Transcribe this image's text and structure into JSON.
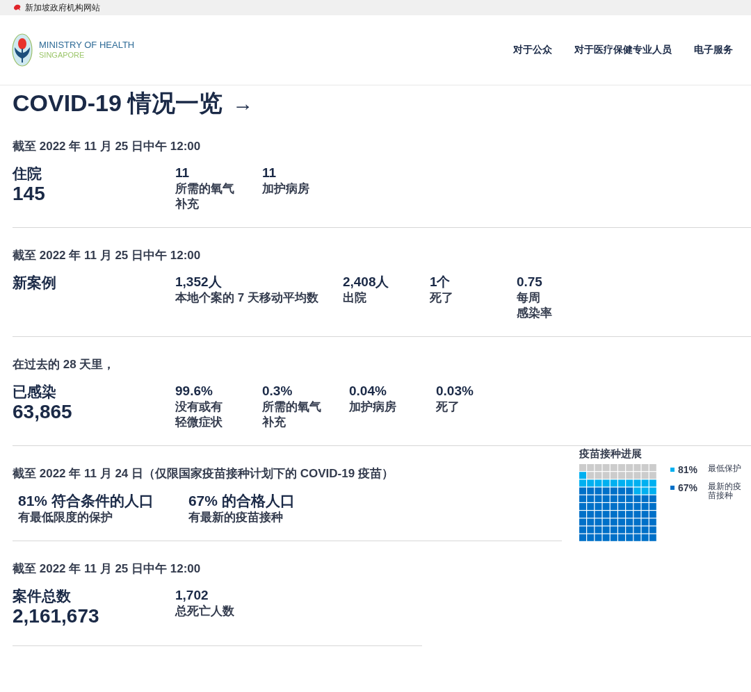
{
  "gov_bar": {
    "text": "新加坡政府机构网站"
  },
  "header": {
    "logo_title": "MINISTRY OF HEALTH",
    "logo_subtitle": "SINGAPORE",
    "nav": [
      "对于公众",
      "对于医疗保健专业人员",
      "电子服务"
    ]
  },
  "page_title": {
    "text": "COVID-19 情况一览",
    "arrow": "→"
  },
  "sections": [
    {
      "date": "截至 2022 年 11 月 25 日中午 12:00",
      "headline": "住院",
      "total": "145",
      "stats": [
        {
          "value": "11",
          "label_lines": [
            "所需的氧气",
            "补充"
          ]
        },
        {
          "value": "11",
          "label_lines": [
            "加护病房"
          ]
        }
      ]
    },
    {
      "date": "截至 2022 年 11 月 25 日中午 12:00",
      "headline": "新案例",
      "stats": [
        {
          "value": "1,352人",
          "label_lines": [
            "本地个案的 7 天移动平均数"
          ]
        },
        {
          "value": "2,408人",
          "label_lines": [
            "出院"
          ]
        },
        {
          "value": "1个",
          "label_lines": [
            "死了"
          ]
        },
        {
          "value": "0.75",
          "label_lines": [
            "每周",
            "感染率"
          ]
        }
      ]
    },
    {
      "date": "在过去的 28 天里，",
      "headline": "已感染",
      "total": "63,865",
      "stats": [
        {
          "value": "99.6%",
          "label_lines": [
            "没有或有",
            "轻微症状"
          ]
        },
        {
          "value": "0.3%",
          "label_lines": [
            "所需的氧气",
            "补充"
          ]
        },
        {
          "value": "0.04%",
          "label_lines": [
            "加护病房"
          ]
        },
        {
          "value": "0.03%",
          "label_lines": [
            "死了"
          ]
        }
      ]
    }
  ],
  "vaccination": {
    "date": "截至 2022 年 11 月 24 日（仅限国家疫苗接种计划下的 COVID-19 疫苗）",
    "stats": [
      {
        "title": "81% 符合条件的人口",
        "subtitle": "有最低限度的保护"
      },
      {
        "title": "67% 的合格人口",
        "subtitle": "有最新的疫苗接种"
      }
    ],
    "progress": {
      "title": "疫苗接种进展",
      "legend": [
        {
          "value": "81%",
          "label_lines": [
            "最低保护"
          ],
          "color": "#00b0f0"
        },
        {
          "value": "67%",
          "label_lines": [
            "最新的疫",
            "苗接种"
          ],
          "color": "#0070c8"
        }
      ]
    }
  },
  "totals": {
    "date": "截至 2022 年 11 月 25 日中午 12:00",
    "headline": "案件总数",
    "total": "2,161,673",
    "stats": [
      {
        "value": "1,702",
        "label_lines": [
          "总死亡人数"
        ]
      }
    ]
  }
}
